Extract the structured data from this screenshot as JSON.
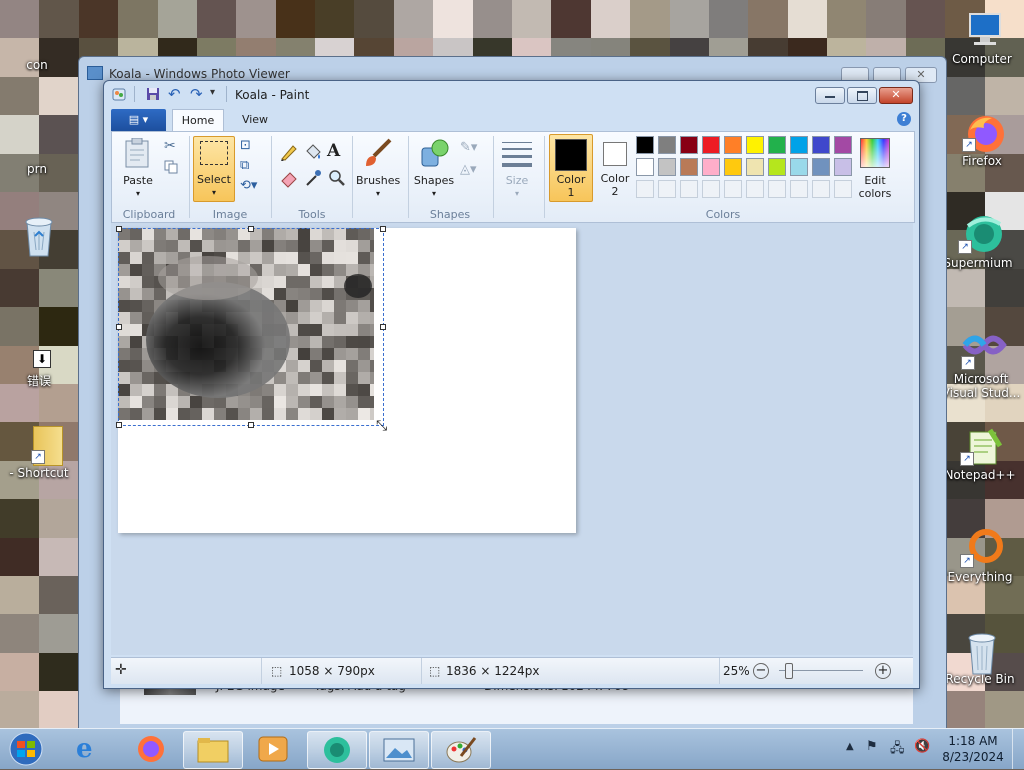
{
  "desktop": {
    "icons_left": [
      {
        "label": "con"
      },
      {
        "label": "prn"
      },
      {
        "label": "错误"
      },
      {
        "label": "- Shortcut"
      }
    ],
    "icons_right": [
      {
        "label": "Computer"
      },
      {
        "label": "Firefox"
      },
      {
        "label": "Supermium"
      },
      {
        "label": "Microsoft Visual Stud..."
      },
      {
        "label": "Notepad++"
      },
      {
        "label": "Everything"
      },
      {
        "label": "Recycle Bin"
      }
    ]
  },
  "photo_viewer": {
    "title": "Koala - Windows Photo Viewer",
    "file_type": "JPEG image",
    "tags_label": "Tags:",
    "tags_value": "Add a tag",
    "dimensions_label": "Dimensions:",
    "dimensions_value": "1024 x 768"
  },
  "paint": {
    "title": "Koala - Paint",
    "tabs": [
      {
        "label": "Home"
      },
      {
        "label": "View"
      }
    ],
    "ribbon": {
      "paste": "Paste",
      "select": "Select",
      "brushes": "Brushes",
      "shapes": "Shapes",
      "size": "Size",
      "color1_line1": "Color",
      "color1_line2": "1",
      "color2_line1": "Color",
      "color2_line2": "2",
      "edit_colors_line1": "Edit",
      "edit_colors_line2": "colors",
      "groups": {
        "clipboard": "Clipboard",
        "image": "Image",
        "tools": "Tools",
        "shapes": "Shapes",
        "colors": "Colors"
      }
    },
    "palette_row1": [
      "#000000",
      "#7f7f7f",
      "#880015",
      "#ed1c24",
      "#ff7f27",
      "#fff200",
      "#22b14c",
      "#00a2e8",
      "#3f48cc",
      "#a349a4"
    ],
    "palette_row2": [
      "#ffffff",
      "#c3c3c3",
      "#b97a57",
      "#ffaec9",
      "#ffc90e",
      "#efe4b0",
      "#b5e61d",
      "#99d9ea",
      "#7092be",
      "#c8bfe7"
    ],
    "color1": "#000000",
    "color2": "#ffffff",
    "status": {
      "selection_size": "1058 × 790px",
      "image_size": "1836 × 1224px",
      "zoom": "25%"
    }
  },
  "taskbar": {
    "time": "1:18 AM",
    "date": "8/23/2024",
    "buttons": [
      "start",
      "internet-explorer",
      "firefox",
      "windows-explorer",
      "media-player",
      "supermium",
      "photo-viewer",
      "paint"
    ]
  }
}
